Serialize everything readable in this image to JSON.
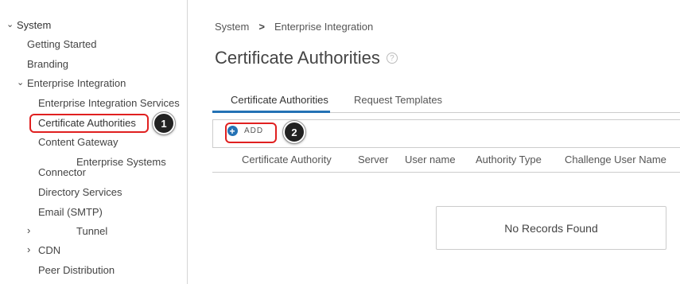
{
  "sidebar": {
    "system_label": "System",
    "getting_started": "Getting Started",
    "branding": "Branding",
    "enterprise_integration": "Enterprise Integration",
    "enterprise_integration_services": "Enterprise Integration Services",
    "certificate_authorities": "Certificate Authorities",
    "content_gateway": "Content Gateway",
    "enterprise_systems_connector_1": "Enterprise Systems",
    "enterprise_systems_connector_2": "Connector",
    "directory_services": "Directory Services",
    "email_smtp": "Email (SMTP)",
    "tunnel": "Tunnel",
    "cdn": "CDN",
    "peer_distribution": "Peer Distribution"
  },
  "callouts": {
    "one": "1",
    "two": "2"
  },
  "breadcrumb": {
    "root": "System",
    "current": "Enterprise Integration"
  },
  "page": {
    "title": "Certificate Authorities",
    "help_glyph": "?"
  },
  "tabs": {
    "certificate_authorities": "Certificate Authorities",
    "request_templates": "Request Templates"
  },
  "toolbar": {
    "add_label": "ADD",
    "add_glyph": "+"
  },
  "table": {
    "columns": [
      "Certificate Authority",
      "Server",
      "User name",
      "Authority Type",
      "Challenge User Name"
    ],
    "empty_message": "No Records Found"
  },
  "colors": {
    "accent": "#2472b5",
    "highlight": "#e02020",
    "callout_bg": "#222222"
  }
}
